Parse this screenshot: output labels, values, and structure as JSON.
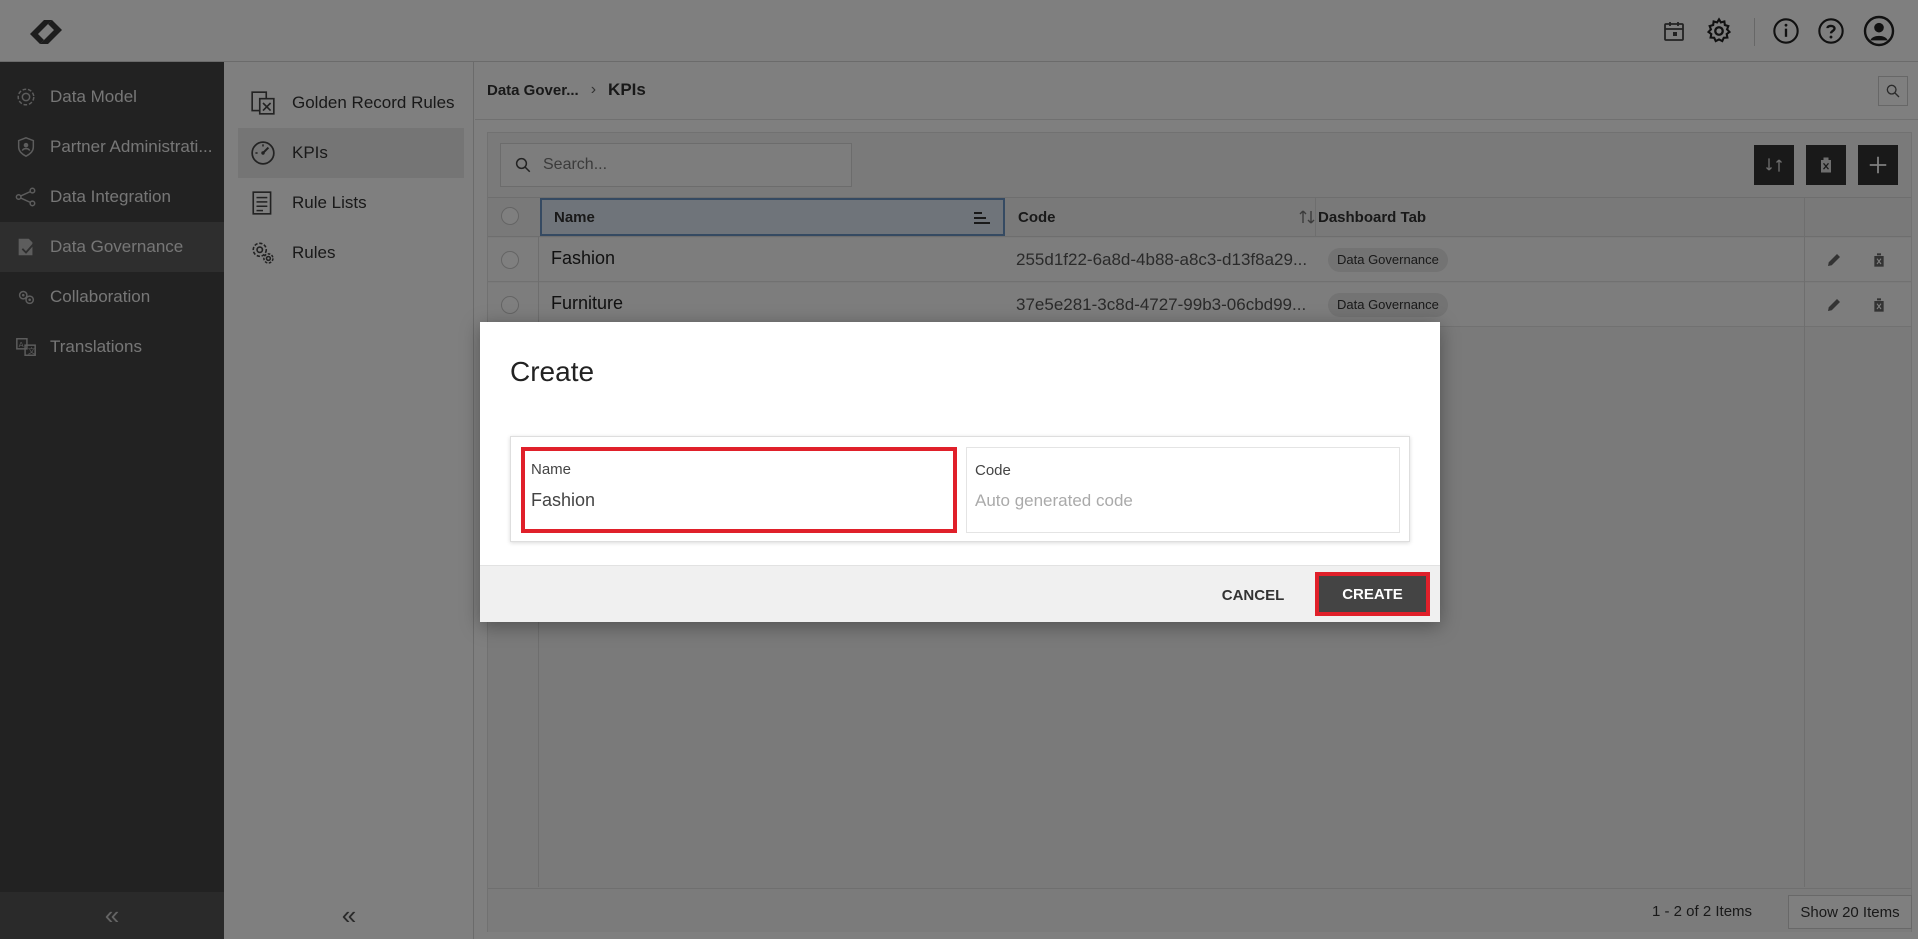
{
  "header": {
    "icons": [
      "logo-icon",
      "calendar-icon",
      "gear-icon",
      "info-icon",
      "help-icon",
      "user-icon"
    ]
  },
  "sidebar": {
    "items": [
      {
        "label": "Data Model",
        "icon": "data-model-icon"
      },
      {
        "label": "Partner Administrati...",
        "icon": "shield-icon"
      },
      {
        "label": "Data Integration",
        "icon": "integration-icon"
      },
      {
        "label": "Data Governance",
        "icon": "governance-icon",
        "active": true
      },
      {
        "label": "Collaboration",
        "icon": "collaboration-icon"
      },
      {
        "label": "Translations",
        "icon": "translation-icon"
      }
    ],
    "collapse": "«"
  },
  "submenu": {
    "items": [
      {
        "label": "Golden Record Rules",
        "icon": "golden-record-icon"
      },
      {
        "label": "KPIs",
        "icon": "gauge-icon",
        "active": true
      },
      {
        "label": "Rule Lists",
        "icon": "list-icon"
      },
      {
        "label": "Rules",
        "icon": "rules-gear-icon"
      }
    ],
    "collapse": "«"
  },
  "breadcrumb": {
    "parent": "Data Gover...",
    "separator": "›",
    "current": "KPIs"
  },
  "grid": {
    "search_placeholder": "Search...",
    "columns": {
      "name": "Name",
      "code": "Code",
      "dashboard": "Dashboard Tab"
    },
    "rows": [
      {
        "name": "Fashion",
        "code": "255d1f22-6a8d-4b88-a8c3-d13f8a29...",
        "dashboard": "Data Governance"
      },
      {
        "name": "Furniture",
        "code": "37e5e281-3c8d-4727-99b3-06cbd99...",
        "dashboard": "Data Governance"
      }
    ],
    "pager": {
      "count": "1 - 2 of 2 Items",
      "show": "Show 20 Items"
    }
  },
  "modal": {
    "title": "Create",
    "name_label": "Name",
    "name_value": "Fashion",
    "code_label": "Code",
    "code_placeholder": "Auto generated code",
    "cancel": "CANCEL",
    "create": "CREATE"
  },
  "colors": {
    "sidebar_bg": "#454545",
    "highlight": "#e0202a",
    "primary_button": "#444444",
    "selected_column": "#6a94c4"
  }
}
